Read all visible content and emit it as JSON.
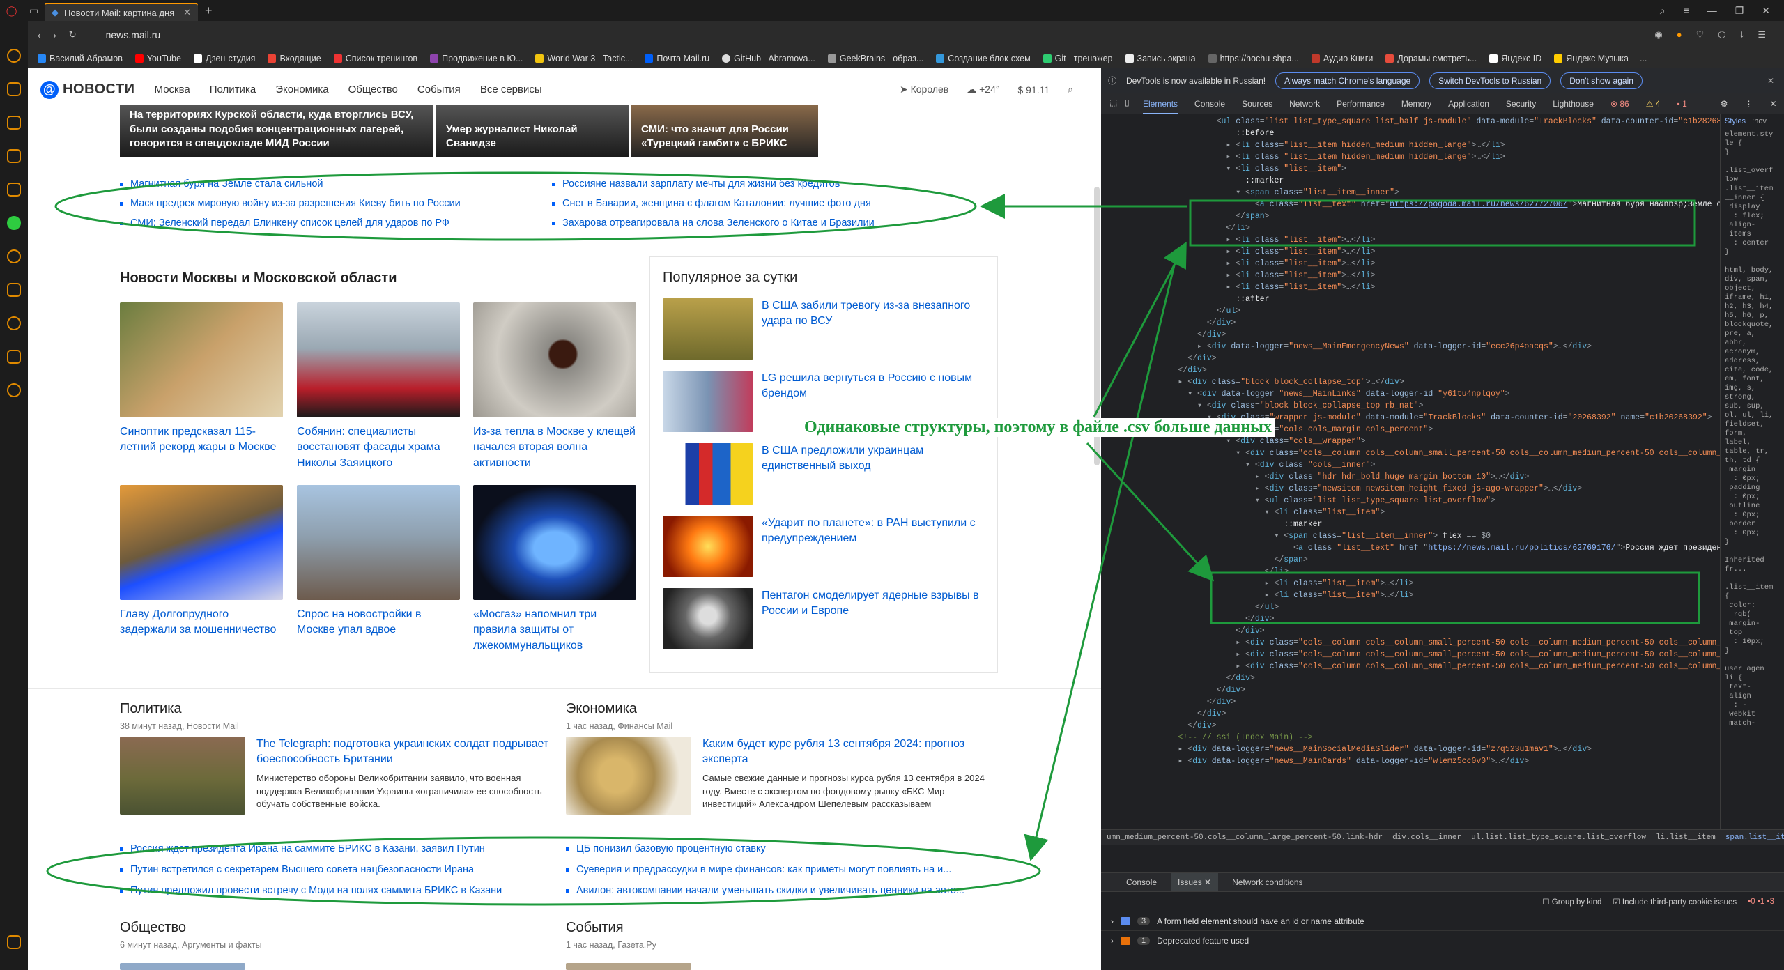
{
  "browser": {
    "tab_title": "Новости Mail: картина дня",
    "url": "news.mail.ru",
    "bookmarks": [
      "Василий Абрамов",
      "YouTube",
      "Дзен-студия",
      "Входящие",
      "Список тренингов",
      "Продвижение в Ю...",
      "World War 3 - Tactic...",
      "Почта Mail.ru",
      "GitHub - Abramova...",
      "GeekBrains - образ...",
      "Создание блок-схем",
      "Git - тренажер",
      "Запись экрана",
      "https://hochu-shpa...",
      "Аудио Книги",
      "Дорамы смотреть...",
      "Яндекс ID",
      "Яндекс Музыка —..."
    ]
  },
  "colors": {
    "accent": "#005ff9",
    "link": "#005bd1",
    "annotation": "#1e9a3c",
    "devtools_bg": "#202124"
  },
  "site": {
    "logo": "НОВОСТИ",
    "nav": [
      "Москва",
      "Политика",
      "Экономика",
      "Общество",
      "События",
      "Все сервисы"
    ],
    "city": "Королев",
    "temp": "+24°",
    "currency": "91.11",
    "hero": [
      "На территориях Курской области, куда вторглись ВСУ, были созданы подобия концентрационных лагерей, говорится в спецдокладе МИД России",
      "Умер журналист Николай Сванидзе",
      "СМИ: что значит для России «Турецкий гамбит» с БРИКС"
    ],
    "top_links": [
      "Магнитная буря на Земле стала сильной",
      "Россияне назвали зарплату мечты для жизни без кредитов",
      "Маск предрек мировую войну из-за разрешения Киеву бить по России",
      "Снег в Баварии, женщина с флагом Каталонии: лучшие фото дня",
      "СМИ: Зеленский передал Блинкену список целей для ударов по РФ",
      "Захарова отреагировала на слова Зеленского о Китае и Бразилии"
    ],
    "moscow_title": "Новости Москвы и Московской области",
    "moscow_cards": [
      "Синоптик предсказал 115-летний рекорд жары в Москве",
      "Собянин: специалисты восстановят фасады храма Николы Заяицкого",
      "Из-за тепла в Москве у клещей начался вторая волна активности",
      "Главу Долгопрудного задержали за мошенничество",
      "Спрос на новостройки в Москве упал вдвое",
      "«Мосгаз» напомнил три правила защиты от лжекоммунальщиков"
    ],
    "popular_title": "Популярное за сутки",
    "popular": [
      "В США забили тревогу из-за внезапного удара по ВСУ",
      "LG решила вернуться в Россию с новым брендом",
      "В США предложили украинцам единственный выход",
      "«Ударит по планете»: в РАН выступили с предупреждением",
      "Пентагон смоделирует ядерные взрывы в России и Европе"
    ],
    "politics": {
      "title": "Политика",
      "meta": "38 минут назад, Новости Mail",
      "lead": "The Telegraph: подготовка украинских солдат подрывает боеспособность Британии",
      "desc": "Министерство обороны Великобритании заявило, что военная поддержка Великобритании Украины «ограничила» ее способность обучать собственные войска."
    },
    "economy": {
      "title": "Экономика",
      "meta": "1 час назад, Финансы Mail",
      "lead": "Каким будет курс рубля 13 сентября 2024: прогноз эксперта",
      "desc": "Самые свежие данные и прогнозы курса рубля 13 сентября в 2024 году. Вместе с экспертом по фондовому рынку «БКС Мир инвестиций» Александром Шепелевым рассказываем"
    },
    "bottom_links": [
      "Россия ждет президента Ирана на саммите БРИКС в Казани, заявил Путин",
      "ЦБ понизил базовую процентную ставку",
      "Путин встретился с секретарем Высшего совета нацбезопасности Ирана",
      "Суеверия и предрассудки в мире финансов: как приметы могут повлиять на и...",
      "Путин предложил провести встречу с Моди на полях саммита БРИКС в Казани",
      "Авилон: автокомпании начали уменьшать скидки и увеличивать ценники на авто..."
    ],
    "society": {
      "title": "Общество",
      "meta": "6 минут назад, Аргументы и факты"
    },
    "events": {
      "title": "События",
      "meta": "1 час назад, Газета.Ру"
    }
  },
  "devtools": {
    "banner": "DevTools is now available in Russian!",
    "banner_btns": [
      "Always match Chrome's language",
      "Switch DevTools to Russian",
      "Don't show again"
    ],
    "tabs": [
      "Elements",
      "Console",
      "Sources",
      "Network",
      "Performance",
      "Memory",
      "Application",
      "Security",
      "Lighthouse"
    ],
    "errors": "86",
    "warnings": "4",
    "info": "1",
    "styles_tab": "Styles",
    "crumbs": [
      "umn_medium_percent-50.cols__column_large_percent-50.link-hdr",
      "div.cols__inner",
      "ul.list.list_type_square.list_overflow",
      "li.list__item",
      "span.list__item__inner"
    ],
    "drawer_tabs": [
      "Console",
      "Issues",
      "Network conditions"
    ],
    "group_by_kind": "Group by kind",
    "third_party": "Include third-party cookie issues",
    "issues": [
      {
        "count": "3",
        "text": "A form field element should have an id or name attribute"
      },
      {
        "count": "1",
        "text": "Deprecated feature used"
      }
    ],
    "link1": "https://pogoda.mail.ru/news/62772706/",
    "text1": "Магнитная буря на&nbsp;Земле стала сильной",
    "link2": "https://news.mail.ru/politics/62769176/",
    "text2": "Россия ждет президента Ирана на саммите БРИКС в Казани, заявил Путин"
  },
  "annotation": "Одинаковые структуры, поэтому в файле .csv больше данных"
}
